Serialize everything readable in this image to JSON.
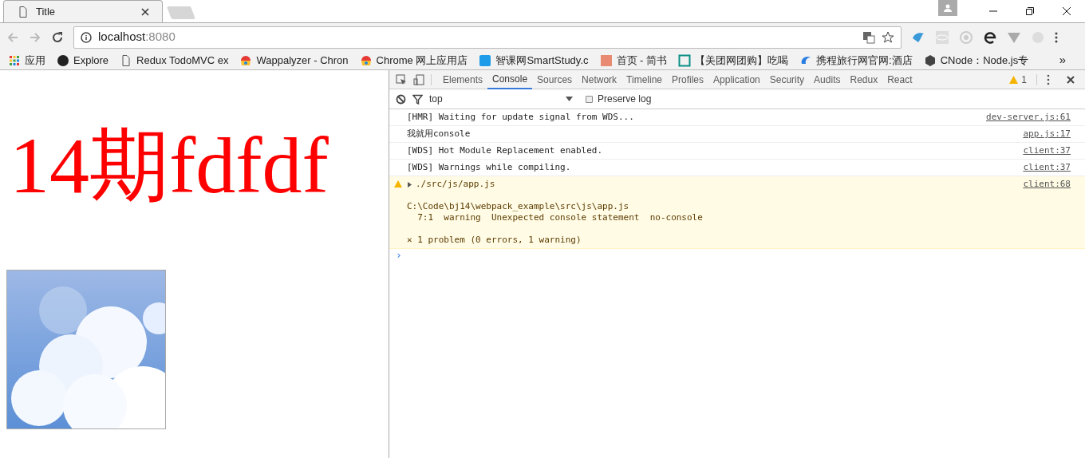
{
  "browser": {
    "tabs": [
      {
        "title": "Title",
        "selected": true
      }
    ],
    "address": {
      "host": "localhost",
      "port": ":8080"
    },
    "bookmarks": [
      {
        "label": "应用",
        "kind": "apps"
      },
      {
        "label": "Explore",
        "kind": "github"
      },
      {
        "label": "Redux TodoMVC ex",
        "kind": "page"
      },
      {
        "label": "Wappalyzer - Chron",
        "kind": "store"
      },
      {
        "label": "Chrome 网上应用店",
        "kind": "store"
      },
      {
        "label": "智课网SmartStudy.c",
        "kind": "zhi"
      },
      {
        "label": "首页 - 简书",
        "kind": "jian"
      },
      {
        "label": "【美团网团购】吃喝",
        "kind": "tuan"
      },
      {
        "label": "携程旅行网官网:酒店",
        "kind": "ctrip"
      },
      {
        "label": "CNode：Node.js专",
        "kind": "cnode"
      }
    ],
    "more": "»"
  },
  "page": {
    "heading": "14期fdfdf"
  },
  "devtools": {
    "tabs": [
      {
        "label": "Elements",
        "selected": false
      },
      {
        "label": "Console",
        "selected": true
      },
      {
        "label": "Sources",
        "selected": false
      },
      {
        "label": "Network",
        "selected": false
      },
      {
        "label": "Timeline",
        "selected": false
      },
      {
        "label": "Profiles",
        "selected": false
      },
      {
        "label": "Application",
        "selected": false
      },
      {
        "label": "Security",
        "selected": false
      },
      {
        "label": "Audits",
        "selected": false
      },
      {
        "label": "Redux",
        "selected": false
      },
      {
        "label": "React",
        "selected": false
      }
    ],
    "warning_count": "1",
    "context": "top",
    "preserve_log": {
      "label": "Preserve log",
      "checked": false
    },
    "messages": [
      {
        "kind": "log",
        "lines": [
          "[HMR] Waiting for update signal from WDS..."
        ],
        "source": "dev-server.js:61"
      },
      {
        "kind": "log",
        "lines": [
          "我就用console"
        ],
        "source": "app.js:17"
      },
      {
        "kind": "log",
        "lines": [
          "[WDS] Hot Module Replacement enabled."
        ],
        "source": "client:37"
      },
      {
        "kind": "log",
        "lines": [
          "[WDS] Warnings while compiling."
        ],
        "source": "client:37"
      },
      {
        "kind": "warning",
        "expanded": false,
        "lines": [
          "./src/js/app.js",
          {
            "text": "C:\\Code\\bj14\\webpack_example\\src\\js\\app.js",
            "gap_before": true
          },
          "  7:1  warning  Unexpected console statement  no-console",
          {
            "text": "✕ 1 problem (0 errors, 1 warning)",
            "gap_before": true
          }
        ],
        "source": "client:68"
      }
    ],
    "prompt": "›"
  }
}
